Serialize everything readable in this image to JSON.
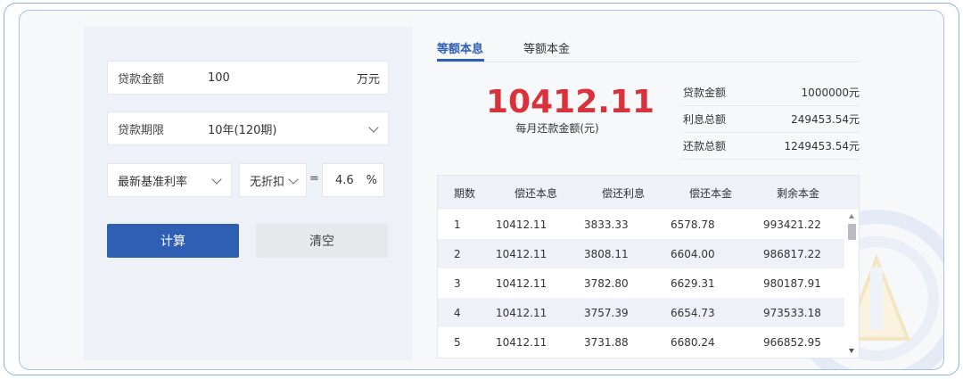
{
  "colors": {
    "accent": "#2f5fb3",
    "highlight_red": "#d8333c",
    "panel_bg": "#eef1f7"
  },
  "form": {
    "amount": {
      "label": "贷款金额",
      "value": "100",
      "unit": "万元"
    },
    "term": {
      "label": "贷款期限",
      "value": "10年(120期)"
    },
    "rate_type": {
      "value": "最新基准利率"
    },
    "discount": {
      "value": "无折扣"
    },
    "equals": "=",
    "rate": {
      "value": "4.6",
      "unit": "%"
    },
    "calc_label": "计算",
    "clear_label": "清空"
  },
  "tabs": [
    {
      "label": "等额本息",
      "active": true
    },
    {
      "label": "等额本金",
      "active": false
    }
  ],
  "result": {
    "monthly_amount": "10412.11",
    "monthly_caption": "每月还款金额(元)",
    "summary": [
      {
        "label": "贷款金额",
        "value": "1000000元"
      },
      {
        "label": "利息总额",
        "value": "249453.54元"
      },
      {
        "label": "还款总额",
        "value": "1249453.54元"
      }
    ]
  },
  "table": {
    "headers": [
      "期数",
      "偿还本息",
      "偿还利息",
      "偿还本金",
      "剩余本金"
    ],
    "rows": [
      [
        "1",
        "10412.11",
        "3833.33",
        "6578.78",
        "993421.22"
      ],
      [
        "2",
        "10412.11",
        "3808.11",
        "6604.00",
        "986817.22"
      ],
      [
        "3",
        "10412.11",
        "3782.80",
        "6629.31",
        "980187.91"
      ],
      [
        "4",
        "10412.11",
        "3757.39",
        "6654.73",
        "973533.18"
      ],
      [
        "5",
        "10412.11",
        "3731.88",
        "6680.24",
        "966852.95"
      ]
    ]
  }
}
